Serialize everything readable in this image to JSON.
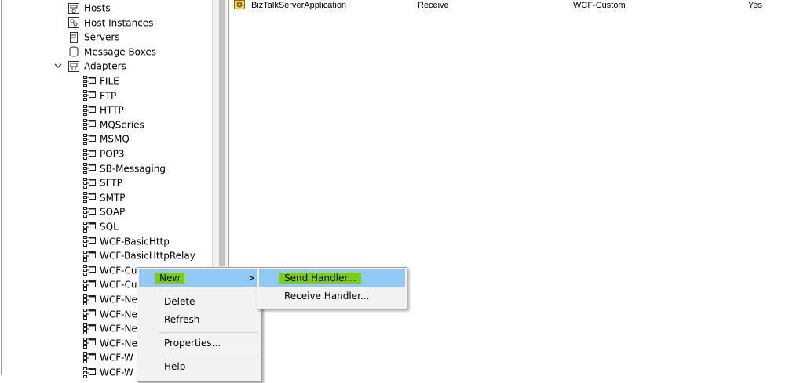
{
  "tree": {
    "items": [
      {
        "label": "Hosts",
        "icon": "hosts-icon"
      },
      {
        "label": "Host Instances",
        "icon": "host-instances-icon"
      },
      {
        "label": "Servers",
        "icon": "servers-icon"
      },
      {
        "label": "Message Boxes",
        "icon": "message-boxes-icon"
      },
      {
        "label": "Adapters",
        "icon": "adapters-icon",
        "expander": "chevron-down-icon"
      },
      {
        "label": "FILE",
        "icon": "adapter-icon"
      },
      {
        "label": "FTP",
        "icon": "adapter-icon"
      },
      {
        "label": "HTTP",
        "icon": "adapter-icon"
      },
      {
        "label": "MQSeries",
        "icon": "adapter-icon"
      },
      {
        "label": "MSMQ",
        "icon": "adapter-icon"
      },
      {
        "label": "POP3",
        "icon": "adapter-icon"
      },
      {
        "label": "SB-Messaging",
        "icon": "adapter-icon"
      },
      {
        "label": "SFTP",
        "icon": "adapter-icon"
      },
      {
        "label": "SMTP",
        "icon": "adapter-icon"
      },
      {
        "label": "SOAP",
        "icon": "adapter-icon"
      },
      {
        "label": "SQL",
        "icon": "adapter-icon"
      },
      {
        "label": "WCF-BasicHttp",
        "icon": "adapter-icon"
      },
      {
        "label": "WCF-BasicHttpRelay",
        "icon": "adapter-icon"
      },
      {
        "label": "WCF-Cu",
        "icon": "adapter-icon"
      },
      {
        "label": "WCF-Cu",
        "icon": "adapter-icon"
      },
      {
        "label": "WCF-Ne",
        "icon": "adapter-icon"
      },
      {
        "label": "WCF-Ne",
        "icon": "adapter-icon"
      },
      {
        "label": "WCF-Ne",
        "icon": "adapter-icon"
      },
      {
        "label": "WCF-Ne",
        "icon": "adapter-icon"
      },
      {
        "label": "WCF-W",
        "icon": "adapter-icon"
      },
      {
        "label": "WCF-W",
        "icon": "adapter-icon"
      }
    ]
  },
  "list": {
    "row": {
      "name": "BizTalkServerApplication",
      "direction": "Receive",
      "adapter": "WCF-Custom",
      "default": "Yes",
      "icon": "application-icon"
    }
  },
  "context_menu": {
    "new_label": "New",
    "delete_label": "Delete",
    "refresh_label": "Refresh",
    "properties_label": "Properties...",
    "help_label": "Help",
    "submenu_arrow": ">"
  },
  "submenu": {
    "send_handler_label": "Send Handler...",
    "receive_handler_label": "Receive Handler..."
  },
  "colors": {
    "highlight": "#91c9f7",
    "green_marker": "#7ad000",
    "menu_bg": "#f2f2f2"
  }
}
